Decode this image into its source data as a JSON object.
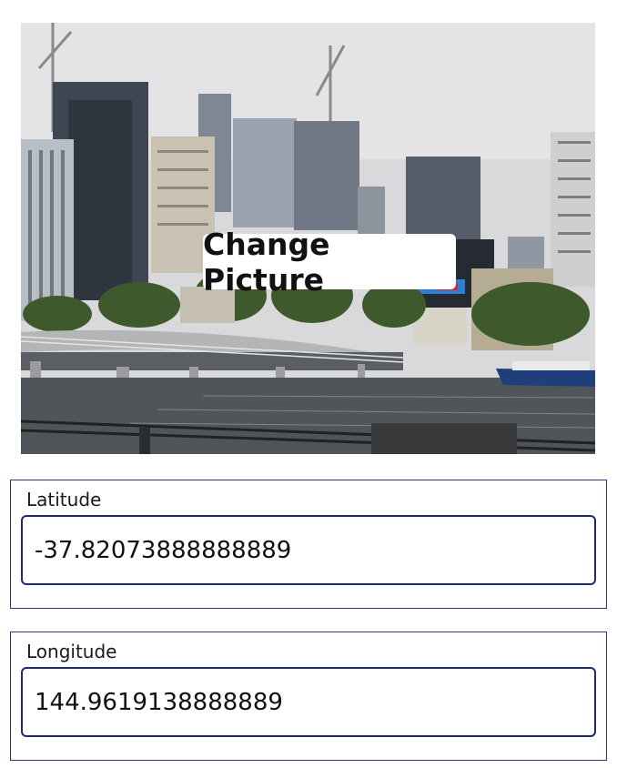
{
  "photo": {
    "button_label": "Change Picture"
  },
  "latitude": {
    "label": "Latitude",
    "value": "-37.82073888888889"
  },
  "longitude": {
    "label": "Longitude",
    "value": "144.9619138888889"
  }
}
